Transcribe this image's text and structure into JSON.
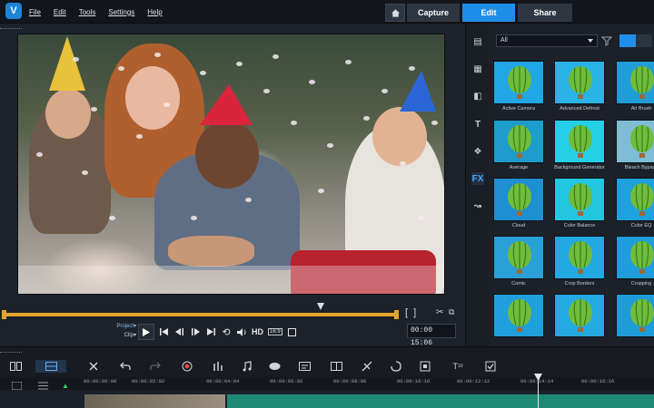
{
  "menu": {
    "logo": "V",
    "items": [
      "File",
      "Edit",
      "Tools",
      "Settings",
      "Help"
    ]
  },
  "tabs": [
    {
      "label": "Capture"
    },
    {
      "label": "Edit"
    },
    {
      "label": "Share"
    }
  ],
  "player": {
    "mode_project": "Project▾",
    "mode_clip": "Clip▾",
    "hd_label": "HD",
    "speed_label": "16:9",
    "timecode": "00:00 15:06"
  },
  "library": {
    "filter_value": "All",
    "thumbnails": [
      {
        "label": "Active Camera",
        "bg": "#21a6e6"
      },
      {
        "label": "Advanced Defrost",
        "bg": "#29b3e6"
      },
      {
        "label": "Air Brush",
        "bg": "#1f9ed8"
      },
      {
        "label": "Average",
        "bg": "#1e9ccc"
      },
      {
        "label": "Background Generator",
        "bg": "#24d0e8"
      },
      {
        "label": "Bleach Bypass",
        "bg": "#7fbcd6"
      },
      {
        "label": "Cloud",
        "bg": "#1f8ed2"
      },
      {
        "label": "Color Balance",
        "bg": "#22c6e0"
      },
      {
        "label": "Color EQ",
        "bg": "#1da2de"
      },
      {
        "label": "Comic",
        "bg": "#2b9fd8"
      },
      {
        "label": "Crop Borders",
        "bg": "#24a8e2"
      },
      {
        "label": "Cropping",
        "bg": "#1f9ddc"
      },
      {
        "label": "",
        "bg": "#1f9fdc"
      },
      {
        "label": "",
        "bg": "#24a9e2"
      },
      {
        "label": "",
        "bg": "#1e9cd6"
      }
    ]
  },
  "ruler": {
    "ticks": [
      "00:00:00:00",
      "00:00:02:02",
      "00:00:04:04",
      "00:00:06:06",
      "00:00:08:08",
      "00:00:10:10",
      "00:00:12:12",
      "00:00:14:14",
      "00:00:16:16"
    ]
  },
  "colors": {
    "accent": "#1f8ee8",
    "scrubber": "#e3a52a",
    "audio_clip": "#1f8a74"
  }
}
